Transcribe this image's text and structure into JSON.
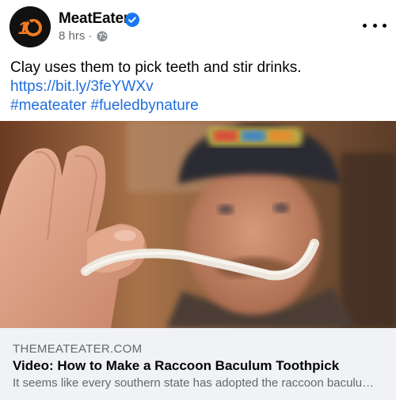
{
  "post": {
    "page_name": "MeatEater",
    "avatar_text": "10",
    "time": "8 hrs",
    "separator": "·",
    "audience_icon": "globe-icon",
    "more_icon": "more-options-icon",
    "verified_icon": "verified-badge-icon",
    "text_line1": "Clay uses them to pick teeth and stir drinks.",
    "link_url": "https://bit.ly/3feYWXv",
    "hashtag1": "#meateater",
    "hashtag2": "#fueledbynature"
  },
  "link_preview": {
    "domain": "THEMEATEATER.COM",
    "title": "Video: How to Make a Raccoon Baculum Toothpick",
    "description": "It seems like every southern state has adopted the raccoon baculu…"
  },
  "colors": {
    "link": "#216fdb",
    "verified": "#1877f2",
    "avatar_bg": "#111111",
    "avatar_accent": "#f47b20",
    "card_bg": "#f0f2f5"
  }
}
